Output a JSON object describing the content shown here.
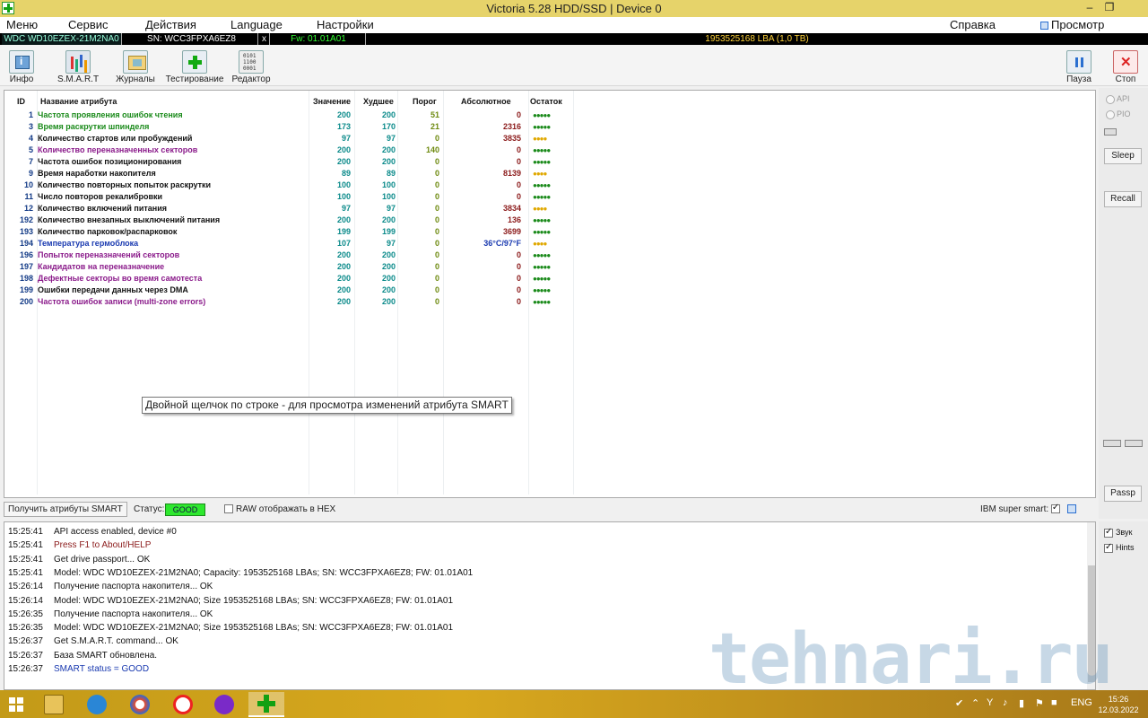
{
  "window": {
    "title": "Victoria 5.28 HDD/SSD | Device 0",
    "buttons": [
      "–",
      "❐"
    ]
  },
  "menu": {
    "items": [
      "Меню",
      "Сервис",
      "Действия",
      "Language",
      "Настройки",
      "Справка"
    ],
    "buffer_view": "Просмотр буфера"
  },
  "device": {
    "model": "WDC WD10EZEX-21M2NA0",
    "sn": "SN: WCC3FPXA6EZ8",
    "close": "x",
    "fw": "Fw: 01.01A01",
    "lba": "1953525168 LBA (1,0 TB)"
  },
  "toolbar": {
    "info": "Инфо",
    "smart": "S.M.A.R.T",
    "journals": "Журналы",
    "testing": "Тестирование",
    "editor": "Редактор",
    "pause": "Пауза",
    "stop": "Стоп"
  },
  "smart_table": {
    "headers": {
      "id": "ID",
      "name": "Название атрибута",
      "value": "Значение",
      "worst": "Худшее",
      "threshold": "Порог",
      "raw": "Абсолютное",
      "rest": "Остаток"
    },
    "rows": [
      {
        "id": "1",
        "name": "Частота проявления ошибок чтения",
        "value": "200",
        "worst": "200",
        "threshold": "51",
        "raw": "0",
        "rest": "●●●●●",
        "color": "#1a8a1a",
        "rest_color": "#1a8a1a"
      },
      {
        "id": "3",
        "name": "Время раскрутки шпинделя",
        "value": "173",
        "worst": "170",
        "threshold": "21",
        "raw": "2316",
        "rest": "●●●●●",
        "color": "#1a8a1a",
        "rest_color": "#1a8a1a"
      },
      {
        "id": "4",
        "name": "Количество стартов или пробуждений",
        "value": "97",
        "worst": "97",
        "threshold": "0",
        "raw": "3835",
        "rest": "●●●●",
        "color": "#111111",
        "rest_color": "#e0a800"
      },
      {
        "id": "5",
        "name": "Количество переназначенных секторов",
        "value": "200",
        "worst": "200",
        "threshold": "140",
        "raw": "0",
        "rest": "●●●●●",
        "color": "#8a1a8a",
        "rest_color": "#1a8a1a"
      },
      {
        "id": "7",
        "name": "Частота ошибок позиционирования",
        "value": "200",
        "worst": "200",
        "threshold": "0",
        "raw": "0",
        "rest": "●●●●●",
        "color": "#111111",
        "rest_color": "#1a8a1a"
      },
      {
        "id": "9",
        "name": "Время наработки накопителя",
        "value": "89",
        "worst": "89",
        "threshold": "0",
        "raw": "8139",
        "rest": "●●●●",
        "color": "#111111",
        "rest_color": "#e0a800"
      },
      {
        "id": "10",
        "name": "Количество повторных попыток раскрутки",
        "value": "100",
        "worst": "100",
        "threshold": "0",
        "raw": "0",
        "rest": "●●●●●",
        "color": "#111111",
        "rest_color": "#1a8a1a"
      },
      {
        "id": "11",
        "name": "Число повторов рекалибровки",
        "value": "100",
        "worst": "100",
        "threshold": "0",
        "raw": "0",
        "rest": "●●●●●",
        "color": "#111111",
        "rest_color": "#1a8a1a"
      },
      {
        "id": "12",
        "name": "Количество включений питания",
        "value": "97",
        "worst": "97",
        "threshold": "0",
        "raw": "3834",
        "rest": "●●●●",
        "color": "#111111",
        "rest_color": "#e0a800"
      },
      {
        "id": "192",
        "name": "Количество внезапных выключений питания",
        "value": "200",
        "worst": "200",
        "threshold": "0",
        "raw": "136",
        "rest": "●●●●●",
        "color": "#111111",
        "rest_color": "#1a8a1a"
      },
      {
        "id": "193",
        "name": "Количество парковок/распарковок",
        "value": "199",
        "worst": "199",
        "threshold": "0",
        "raw": "3699",
        "rest": "●●●●●",
        "color": "#111111",
        "rest_color": "#1a8a1a"
      },
      {
        "id": "194",
        "name": "Температура гермоблока",
        "value": "107",
        "worst": "97",
        "threshold": "0",
        "raw": "36°C/97°F",
        "rest": "●●●●",
        "color": "#1a3ab0",
        "rest_color": "#e0a800",
        "raw_color": "#1a3ab0"
      },
      {
        "id": "196",
        "name": "Попыток переназначений секторов",
        "value": "200",
        "worst": "200",
        "threshold": "0",
        "raw": "0",
        "rest": "●●●●●",
        "color": "#8a1a8a",
        "rest_color": "#1a8a1a"
      },
      {
        "id": "197",
        "name": "Кандидатов на переназначение",
        "value": "200",
        "worst": "200",
        "threshold": "0",
        "raw": "0",
        "rest": "●●●●●",
        "color": "#8a1a8a",
        "rest_color": "#1a8a1a"
      },
      {
        "id": "198",
        "name": "Дефектные секторы во время самотеста",
        "value": "200",
        "worst": "200",
        "threshold": "0",
        "raw": "0",
        "rest": "●●●●●",
        "color": "#8a1a8a",
        "rest_color": "#1a8a1a"
      },
      {
        "id": "199",
        "name": "Ошибки передачи данных через DMA",
        "value": "200",
        "worst": "200",
        "threshold": "0",
        "raw": "0",
        "rest": "●●●●●",
        "color": "#111111",
        "rest_color": "#1a8a1a"
      },
      {
        "id": "200",
        "name": "Частота ошибок записи (multi-zone errors)",
        "value": "200",
        "worst": "200",
        "threshold": "0",
        "raw": "0",
        "rest": "●●●●●",
        "color": "#8a1a8a",
        "rest_color": "#1a8a1a"
      }
    ]
  },
  "tooltip": "Двойной щелчок по строке - для просмотра изменений атрибута SMART",
  "right_panel": {
    "api": "API",
    "pio": "PIO",
    "sleep": "Sleep",
    "recall": "Recall",
    "passp": "Passp"
  },
  "status_bar": {
    "get_smart": "Получить атрибуты SMART",
    "status_label": "Статус:",
    "status_value": "GOOD",
    "raw_hex": "RAW отображать в HEX",
    "ibm": "IBM super smart:"
  },
  "log": [
    {
      "time": "15:25:41",
      "text": "API access enabled, device #0",
      "color": "#111111"
    },
    {
      "time": "15:25:41",
      "text": "Press F1 to About/HELP",
      "color": "#8b1a1a"
    },
    {
      "time": "15:25:41",
      "text": "Get drive passport... OK",
      "color": "#111111"
    },
    {
      "time": "15:25:41",
      "text": "Model: WDC WD10EZEX-21M2NA0; Capacity: 1953525168 LBAs; SN: WCC3FPXA6EZ8; FW: 01.01A01",
      "color": "#111111"
    },
    {
      "time": "15:26:14",
      "text": "Получение паспорта накопителя... OK",
      "color": "#111111"
    },
    {
      "time": "15:26:14",
      "text": "Model: WDC WD10EZEX-21M2NA0; Size 1953525168 LBAs; SN: WCC3FPXA6EZ8; FW: 01.01A01",
      "color": "#111111"
    },
    {
      "time": "15:26:35",
      "text": "Получение паспорта накопителя... OK",
      "color": "#111111"
    },
    {
      "time": "15:26:35",
      "text": "Model: WDC WD10EZEX-21M2NA0; Size 1953525168 LBAs; SN: WCC3FPXA6EZ8; FW: 01.01A01",
      "color": "#111111"
    },
    {
      "time": "15:26:37",
      "text": "Get S.M.A.R.T. command... OK",
      "color": "#111111"
    },
    {
      "time": "15:26:37",
      "text": "База SMART обновлена.",
      "color": "#111111"
    },
    {
      "time": "15:26:37",
      "text": "SMART status = GOOD",
      "color": "#1a3ab0"
    }
  ],
  "right_checks": {
    "sound": "Звук",
    "hints": "Hints"
  },
  "watermark": "tehnari.ru",
  "taskbar": {
    "lang": "ENG",
    "time": "15:26",
    "date": "12.03.2022"
  }
}
